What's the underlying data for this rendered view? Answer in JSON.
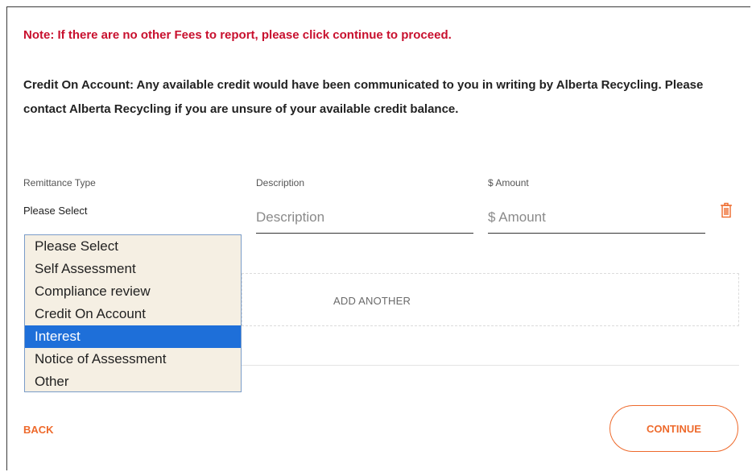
{
  "note": "Note: If there are no other Fees to report, please click continue to proceed.",
  "credit_info": "Credit On Account: Any available credit would have been communicated to you in writing by Alberta Recycling. Please contact Alberta Recycling if you are unsure of your available credit balance.",
  "columns": {
    "remittance_type": "Remittance Type",
    "description": "Description",
    "amount": "$ Amount"
  },
  "remittance_select": {
    "value": "Please Select",
    "highlighted": "Interest",
    "options": [
      "Please Select",
      "Self Assessment",
      "Compliance review",
      "Credit On Account",
      "Interest",
      "Notice of Assessment",
      "Other"
    ]
  },
  "description_field": {
    "value": "",
    "placeholder": "Description"
  },
  "amount_field": {
    "value": "",
    "placeholder": "$ Amount"
  },
  "add_another_label": "ADD ANOTHER",
  "back_label": "BACK",
  "continue_label": "CONTINUE",
  "icons": {
    "delete": "trash-icon"
  },
  "colors": {
    "note_red": "#c8102e",
    "accent_orange": "#ee6a2c",
    "selected_option": "#1e6fd9",
    "dropdown_background": "#f5efe3"
  }
}
